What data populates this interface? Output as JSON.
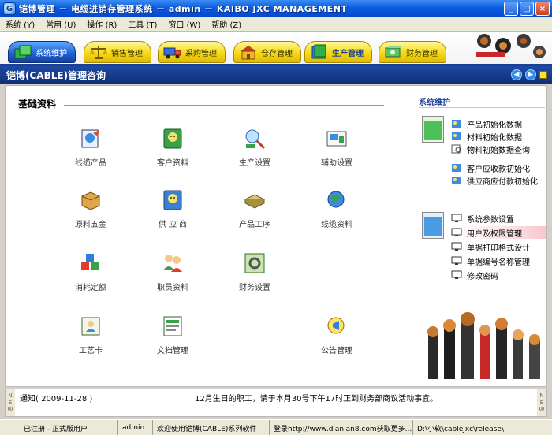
{
  "window": {
    "app_icon_glyph": "G",
    "title": "铠博管理 － 电缆进销存管理系统 － admin － KAIBO JXC MANAGEMENT",
    "buttons": [
      "_",
      "□",
      "×"
    ]
  },
  "menu": [
    "系统 (Y)",
    "常用 (U)",
    "操作 (R)",
    "工具 (T)",
    "窗口 (W)",
    "帮助 (Z)"
  ],
  "tabs": [
    {
      "label": "系统维护",
      "icon": "system-maintain-icon"
    },
    {
      "label": "销售管理",
      "icon": "sales-scale-icon"
    },
    {
      "label": "采购管理",
      "icon": "purchase-truck-icon"
    },
    {
      "label": "仓存管理",
      "icon": "warehouse-icon"
    },
    {
      "label": "生产管理",
      "icon": "production-book-icon"
    },
    {
      "label": "财务管理",
      "icon": "finance-money-icon"
    }
  ],
  "header": {
    "title": "铠博(CABLE)管理咨询",
    "nav_prev": "◀",
    "nav_next": "▶"
  },
  "section": {
    "title": "基础资料"
  },
  "grid": [
    {
      "label": "线缆产品",
      "icon": "cable-product-icon"
    },
    {
      "label": "客户资料",
      "icon": "customer-file-icon"
    },
    {
      "label": "生产设置",
      "icon": "production-settings-icon"
    },
    {
      "label": "辅助设置",
      "icon": "auxiliary-settings-icon"
    },
    {
      "label": "原料五金",
      "icon": "raw-material-box-icon"
    },
    {
      "label": "供 应 商",
      "icon": "supplier-file-icon"
    },
    {
      "label": "产品工序",
      "icon": "product-process-icon"
    },
    {
      "label": "线缆资料",
      "icon": "cable-info-globe-icon"
    },
    {
      "label": "消耗定额",
      "icon": "consumption-cubes-icon"
    },
    {
      "label": "职员资料",
      "icon": "staff-people-icon"
    },
    {
      "label": "财务设置",
      "icon": "finance-settings-icon"
    },
    {
      "label": "工艺卡",
      "icon": "process-card-icon"
    },
    {
      "label": "文档管理",
      "icon": "document-management-icon"
    },
    {
      "label": "公告管理",
      "icon": "announcement-icon"
    }
  ],
  "right_panel": {
    "title": "系统维护",
    "group1": [
      "产品初始化数据",
      "材料初始化数据",
      "物料初始数据查询",
      "客户应收款初始化",
      "供应商应付款初始化"
    ],
    "group2": [
      "系统参数设置",
      "用户及权限管理",
      "单据打印格式设计",
      "单据编号名称管理",
      "修改密码"
    ]
  },
  "notice": {
    "label": "通知( 2009-11-28 )",
    "message": "12月生日的职工，请于本月30号下午17时正到财务部商议活动事宜。",
    "side_left": [
      "N",
      "E",
      "W"
    ],
    "side_right": [
      "N",
      "E",
      "W"
    ]
  },
  "status": {
    "registered": "已注册 - 正式版用户",
    "user": "admin",
    "welcome": "欢迎使用铠博(CABLE)系列软件",
    "login": "登录http://www.dianlan8.com获取更多...",
    "path": "D:\\小软\\cableJxc\\release\\"
  },
  "colors": {
    "accent": "#1c3f96",
    "tab_yellow": "#f5d917",
    "tab_active": "#1d5fd4",
    "highlight_row": "#f6c7cd"
  }
}
